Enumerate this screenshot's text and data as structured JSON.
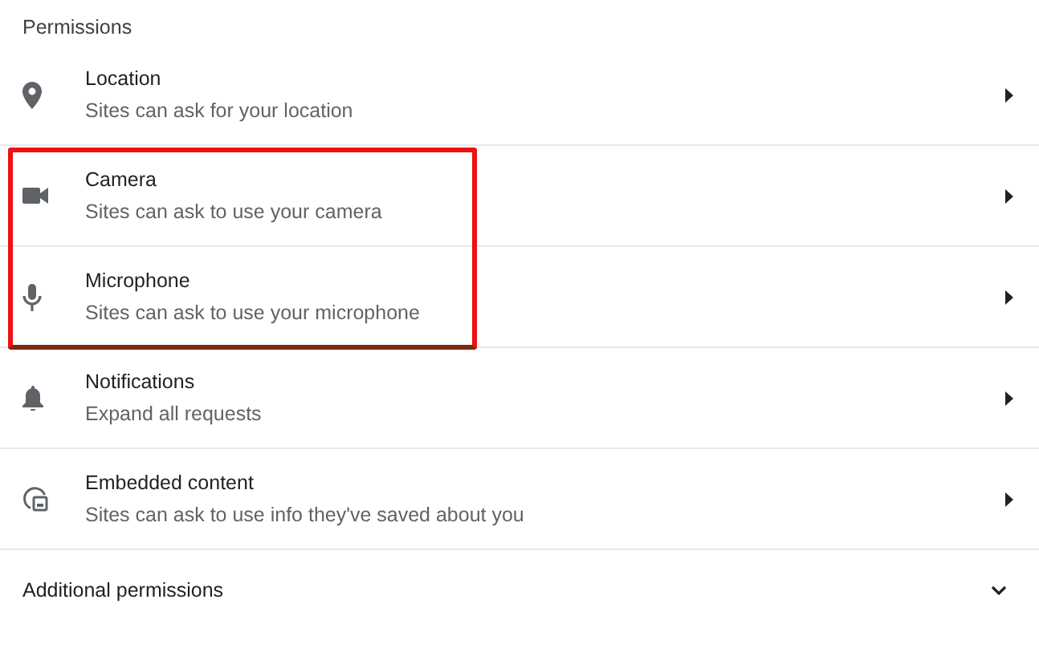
{
  "section_title": "Permissions",
  "permissions": [
    {
      "kind": "location",
      "title": "Location",
      "subtitle": "Sites can ask for your location",
      "highlighted": false
    },
    {
      "kind": "camera",
      "title": "Camera",
      "subtitle": "Sites can ask to use your camera",
      "highlighted": true
    },
    {
      "kind": "microphone",
      "title": "Microphone",
      "subtitle": "Sites can ask to use your microphone",
      "highlighted": true
    },
    {
      "kind": "notifications",
      "title": "Notifications",
      "subtitle": "Expand all requests",
      "highlighted": false
    },
    {
      "kind": "embedded",
      "title": "Embedded content",
      "subtitle": "Sites can ask to use info they've saved about you",
      "highlighted": false
    }
  ],
  "additional": {
    "label": "Additional permissions",
    "expanded": false
  }
}
